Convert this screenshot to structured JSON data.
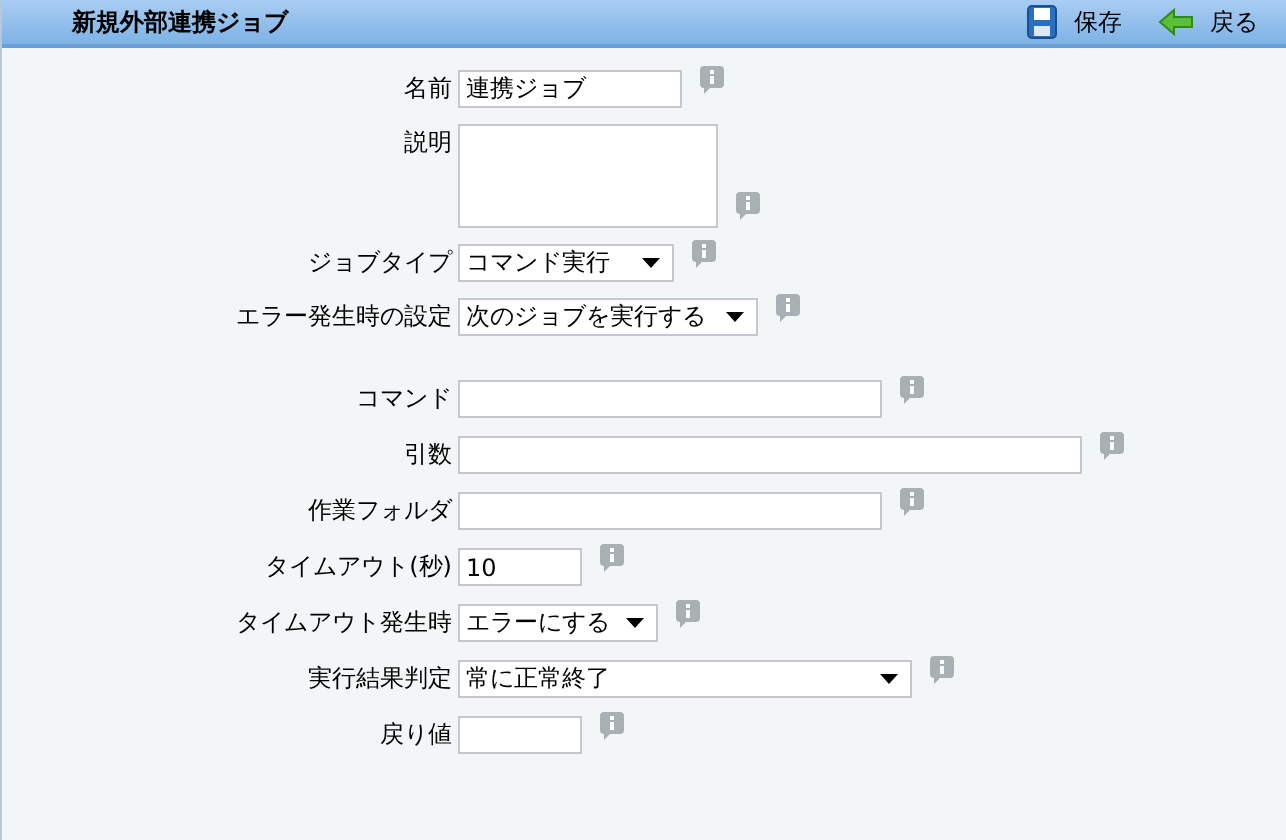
{
  "header": {
    "title": "新規外部連携ジョブ",
    "actions": [
      {
        "kind": "save",
        "label": "保存"
      },
      {
        "kind": "back",
        "label": "戻る"
      }
    ]
  },
  "sections": [
    {
      "fields": [
        {
          "label": "名前",
          "kind": "text",
          "value": "連携ジョブ"
        },
        {
          "label": "説明",
          "kind": "textarea"
        },
        {
          "label": "ジョブタイプ",
          "kind": "select",
          "value": "コマンド実行"
        },
        {
          "label": "エラー発生時の設定",
          "kind": "select",
          "value": "次のジョブを実行する"
        }
      ]
    },
    {
      "fields": [
        {
          "label": "コマンド",
          "kind": "text"
        },
        {
          "label": "引数",
          "kind": "text"
        },
        {
          "label": "作業フォルダ",
          "kind": "text"
        },
        {
          "label": "タイムアウト(秒)",
          "kind": "text",
          "value": "10"
        },
        {
          "label": "タイムアウト発生時",
          "kind": "select",
          "value": "エラーにする"
        },
        {
          "label": "実行結果判定",
          "kind": "select",
          "value": "常に正常終了"
        },
        {
          "label": "戻り値",
          "kind": "text"
        }
      ]
    }
  ]
}
